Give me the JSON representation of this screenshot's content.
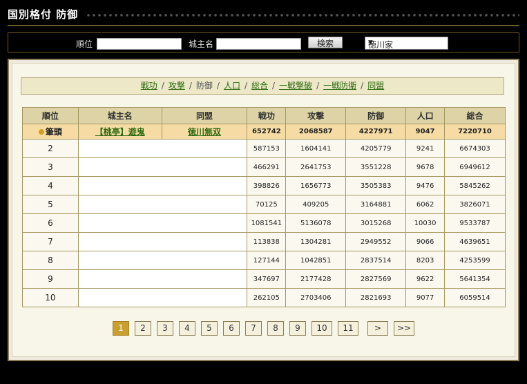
{
  "header": {
    "title": "国別格付 防御"
  },
  "search": {
    "rank_label": "順位",
    "lord_label": "城主名",
    "rank_value": "",
    "lord_value": "",
    "button_label": "検索",
    "nation_selected": "徳川家"
  },
  "tabs": [
    {
      "label": "戦功"
    },
    {
      "label": "攻撃"
    },
    {
      "label": "防御"
    },
    {
      "label": "人口"
    },
    {
      "label": "総合"
    },
    {
      "label": "一戦撃破"
    },
    {
      "label": "一戦防衛"
    },
    {
      "label": "同盟"
    }
  ],
  "table": {
    "headers": {
      "rank": "順位",
      "lord": "城主名",
      "alliance": "同盟",
      "merit": "戦功",
      "attack": "攻撃",
      "defense": "防御",
      "population": "人口",
      "total": "総合"
    },
    "rows": [
      {
        "rank": "筆頭",
        "lord": "【桃亭】遊鬼",
        "alliance": "徳川無双",
        "merit": "652742",
        "attack": "2068587",
        "defense": "4227971",
        "population": "9047",
        "total": "7220710"
      },
      {
        "rank": "2",
        "lord": "",
        "alliance": "",
        "merit": "587153",
        "attack": "1604141",
        "defense": "4205779",
        "population": "9241",
        "total": "6674303"
      },
      {
        "rank": "3",
        "lord": "",
        "alliance": "",
        "merit": "466291",
        "attack": "2641753",
        "defense": "3551228",
        "population": "9678",
        "total": "6949612"
      },
      {
        "rank": "4",
        "lord": "",
        "alliance": "",
        "merit": "398826",
        "attack": "1656773",
        "defense": "3505383",
        "population": "9476",
        "total": "5845262"
      },
      {
        "rank": "5",
        "lord": "",
        "alliance": "",
        "merit": "70125",
        "attack": "409205",
        "defense": "3164881",
        "population": "6062",
        "total": "3826071"
      },
      {
        "rank": "6",
        "lord": "",
        "alliance": "",
        "merit": "1081541",
        "attack": "5136078",
        "defense": "3015268",
        "population": "10030",
        "total": "9533787"
      },
      {
        "rank": "7",
        "lord": "",
        "alliance": "",
        "merit": "113838",
        "attack": "1304281",
        "defense": "2949552",
        "population": "9066",
        "total": "4639651"
      },
      {
        "rank": "8",
        "lord": "",
        "alliance": "",
        "merit": "127144",
        "attack": "1042851",
        "defense": "2837514",
        "population": "8203",
        "total": "4253599"
      },
      {
        "rank": "9",
        "lord": "",
        "alliance": "",
        "merit": "347697",
        "attack": "2177428",
        "defense": "2827569",
        "population": "9622",
        "total": "5641354"
      },
      {
        "rank": "10",
        "lord": "",
        "alliance": "",
        "merit": "262105",
        "attack": "2703406",
        "defense": "2821693",
        "population": "9077",
        "total": "6059514"
      }
    ]
  },
  "pagination": {
    "pages": [
      "1",
      "2",
      "3",
      "4",
      "5",
      "6",
      "7",
      "8",
      "9",
      "10",
      "11"
    ],
    "current": "1",
    "next_label": ">",
    "last_label": ">>"
  },
  "colors": {
    "accent_gold": "#c9a030",
    "link_green": "#2a6a10",
    "top_row": "#f6dca4",
    "header_bg": "#ddd3a6"
  }
}
